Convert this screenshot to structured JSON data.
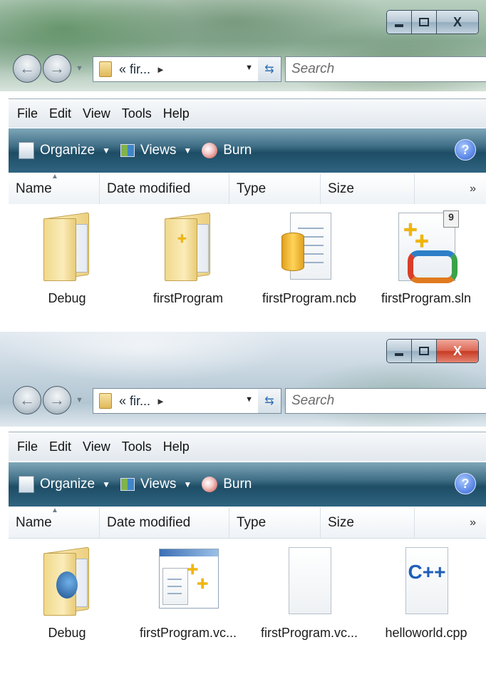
{
  "windows": [
    {
      "address": {
        "path_text": "« fir...",
        "chevron": "►"
      },
      "search": {
        "placeholder": "Search"
      },
      "caption": {
        "minimize": "–",
        "maximize": "□",
        "close": "X"
      },
      "menu": [
        "File",
        "Edit",
        "View",
        "Tools",
        "Help"
      ],
      "commands": {
        "organize": "Organize",
        "views": "Views",
        "burn": "Burn",
        "help": "?"
      },
      "columns": [
        "Name",
        "Date modified",
        "Type",
        "Size",
        "»"
      ],
      "items": [
        {
          "label": "Debug",
          "icon": "folder-icon"
        },
        {
          "label": "firstProgram",
          "icon": "folder-icon"
        },
        {
          "label": "firstProgram.ncb",
          "icon": "database-file-icon"
        },
        {
          "label": "firstProgram.sln",
          "icon": "visual-studio-solution-icon",
          "badge": "9"
        }
      ]
    },
    {
      "address": {
        "path_text": "« fir...",
        "chevron": "►"
      },
      "search": {
        "placeholder": "Search"
      },
      "caption": {
        "minimize": "–",
        "maximize": "□",
        "close": "X"
      },
      "menu": [
        "File",
        "Edit",
        "View",
        "Tools",
        "Help"
      ],
      "commands": {
        "organize": "Organize",
        "views": "Views",
        "burn": "Burn",
        "help": "?"
      },
      "columns": [
        "Name",
        "Date modified",
        "Type",
        "Size",
        "»"
      ],
      "items": [
        {
          "label": "Debug",
          "icon": "folder-icon"
        },
        {
          "label": "firstProgram.vc...",
          "icon": "vc-project-icon"
        },
        {
          "label": "firstProgram.vc...",
          "icon": "blank-file-icon"
        },
        {
          "label": "helloworld.cpp",
          "icon": "cpp-file-icon",
          "badge": "C++"
        }
      ]
    }
  ]
}
